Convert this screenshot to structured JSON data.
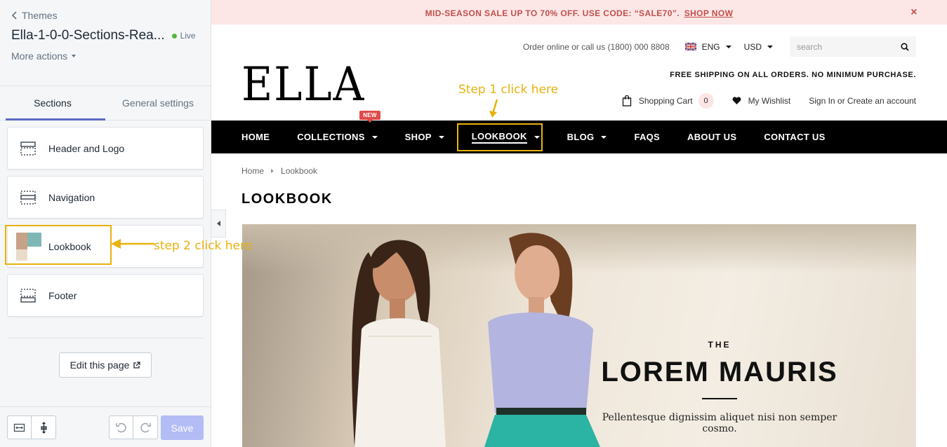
{
  "editor": {
    "back_label": "Themes",
    "theme_name": "Ella-1-0-0-Sections-Rea...",
    "status": "Live",
    "more_actions": "More actions",
    "tabs": [
      {
        "label": "Sections",
        "active": true
      },
      {
        "label": "General settings",
        "active": false
      }
    ],
    "sections": [
      {
        "label": "Header and Logo",
        "icon": "header-section-icon"
      },
      {
        "label": "Navigation",
        "icon": "navigation-section-icon"
      },
      {
        "label": "Lookbook",
        "icon": "lookbook-thumbnail"
      },
      {
        "label": "Footer",
        "icon": "footer-section-icon"
      }
    ],
    "edit_page_label": "Edit this page",
    "save_label": "Save",
    "accent_color": "#5c6ac4"
  },
  "store": {
    "promo": {
      "text": "MID-SEASON SALE UP TO 70% OFF. USE CODE: “SALE70”.",
      "link": "SHOP NOW",
      "close": "×"
    },
    "contact": "Order online or call us (1800) 000 8808",
    "language": "ENG",
    "currency": "USD",
    "search_placeholder": "search",
    "logo": "ELLA",
    "free_shipping": "FREE SHIPPING ON ALL ORDERS. NO MINIMUM PURCHASE.",
    "cart_label": "Shopping Cart",
    "cart_count": "0",
    "wishlist_label": "My Wishlist",
    "account_label": "Sign In or Create an account",
    "nav": [
      {
        "label": "HOME",
        "dropdown": false
      },
      {
        "label": "COLLECTIONS",
        "dropdown": true,
        "badge": "NEW"
      },
      {
        "label": "SHOP",
        "dropdown": true
      },
      {
        "label": "LOOKBOOK",
        "dropdown": true,
        "active": true
      },
      {
        "label": "BLOG",
        "dropdown": true
      },
      {
        "label": "FAQS",
        "dropdown": false
      },
      {
        "label": "ABOUT US",
        "dropdown": false
      },
      {
        "label": "CONTACT US",
        "dropdown": false
      }
    ],
    "breadcrumb": [
      "Home",
      "Lookbook"
    ],
    "page_title": "LOOKBOOK",
    "hero": {
      "subtitle": "THE",
      "title": "LOREM MAURIS",
      "description": "Pellentesque dignissim aliquet nisi non semper cosmo."
    }
  },
  "annotations": {
    "step1": "Step 1 click here",
    "step2": "step 2 click here",
    "color": "#e8b10c"
  }
}
